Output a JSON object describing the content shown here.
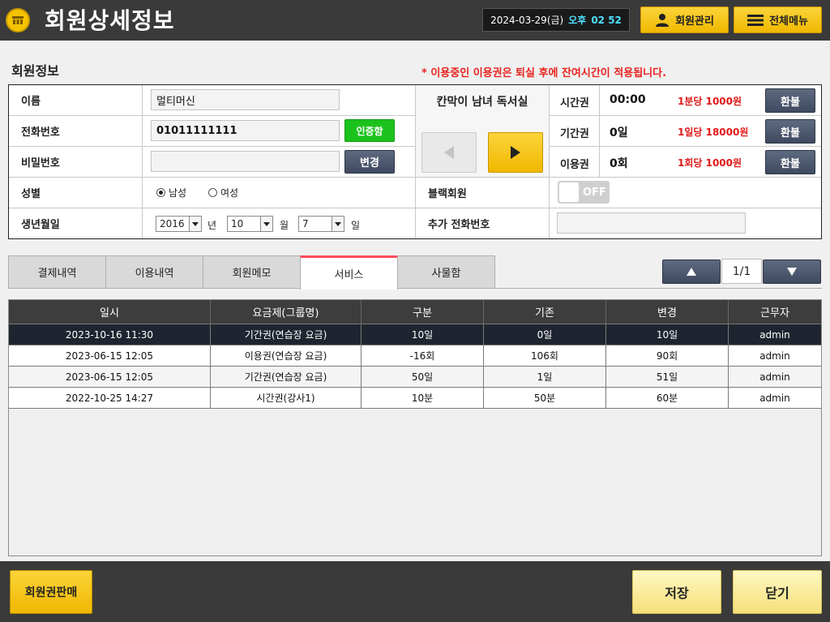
{
  "header": {
    "title": "회원상세정보",
    "clock_date": "2024-03-29(금)",
    "clock_ampm": "오후",
    "clock_time": "02 52",
    "member_mgmt_label": "회원관리",
    "all_menu_label": "전체메뉴"
  },
  "member_info": {
    "section_title": "회원정보",
    "notice": "* 이용중인 이용권은 퇴실 후에 잔여시간이 적용됩니다.",
    "name_label": "이름",
    "name_value": "멀티머신",
    "phone_label": "전화번호",
    "phone_value": "01011111111",
    "verify_button": "인증함",
    "password_label": "비밀번호",
    "password_value": "",
    "change_button": "변경",
    "gender_label": "성별",
    "gender_male": "남성",
    "gender_female": "여성",
    "gender_selected": "male",
    "birth_label": "생년월일",
    "birth_year": "2016",
    "birth_year_unit": "년",
    "birth_month": "10",
    "birth_month_unit": "월",
    "birth_day": "7",
    "birth_day_unit": "일",
    "room_name": "칸막이 남녀 독서실",
    "blacklist_label": "블랙회원",
    "blacklist_toggle": "OFF",
    "extra_phone_label": "추가 전화번호",
    "extra_phone_value": ""
  },
  "tickets": [
    {
      "name": "시간권",
      "value": "00:00",
      "price": "1분당  1000원",
      "button": "환불"
    },
    {
      "name": "기간권",
      "value": "0일",
      "price": "1일당  18000원",
      "button": "환불"
    },
    {
      "name": "이용권",
      "value": "0회",
      "price": "1회당  1000원",
      "button": "환불"
    }
  ],
  "tabs": [
    {
      "label": "결제내역"
    },
    {
      "label": "이용내역"
    },
    {
      "label": "회원메모"
    },
    {
      "label": "서비스"
    },
    {
      "label": "사물함"
    }
  ],
  "active_tab": "서비스",
  "pagination": {
    "label": "1/1"
  },
  "grid": {
    "columns": [
      "일시",
      "요금제(그룹명)",
      "구분",
      "기존",
      "변경",
      "근무자"
    ],
    "rows": [
      [
        "2023-10-16 11:30",
        "기간권(연습장 요금)",
        "10일",
        "0일",
        "10일",
        "admin"
      ],
      [
        "2023-06-15 12:05",
        "이용권(연습장 요금)",
        "-16회",
        "106회",
        "90회",
        "admin"
      ],
      [
        "2023-06-15 12:05",
        "기간권(연습장 요금)",
        "50일",
        "1일",
        "51일",
        "admin"
      ],
      [
        "2022-10-25 14:27",
        "시간권(강사1)",
        "10분",
        "50분",
        "60분",
        "admin"
      ]
    ]
  },
  "footer": {
    "sell_label": "회원권판매",
    "save_label": "저장",
    "close_label": "닫기"
  },
  "colors": {
    "accent_yellow": "#f5c400",
    "notice_red": "#e8231f",
    "verify_green": "#1cc21c",
    "navy_button": "#4a556b",
    "tab_active_border": "#ff4c5a"
  }
}
